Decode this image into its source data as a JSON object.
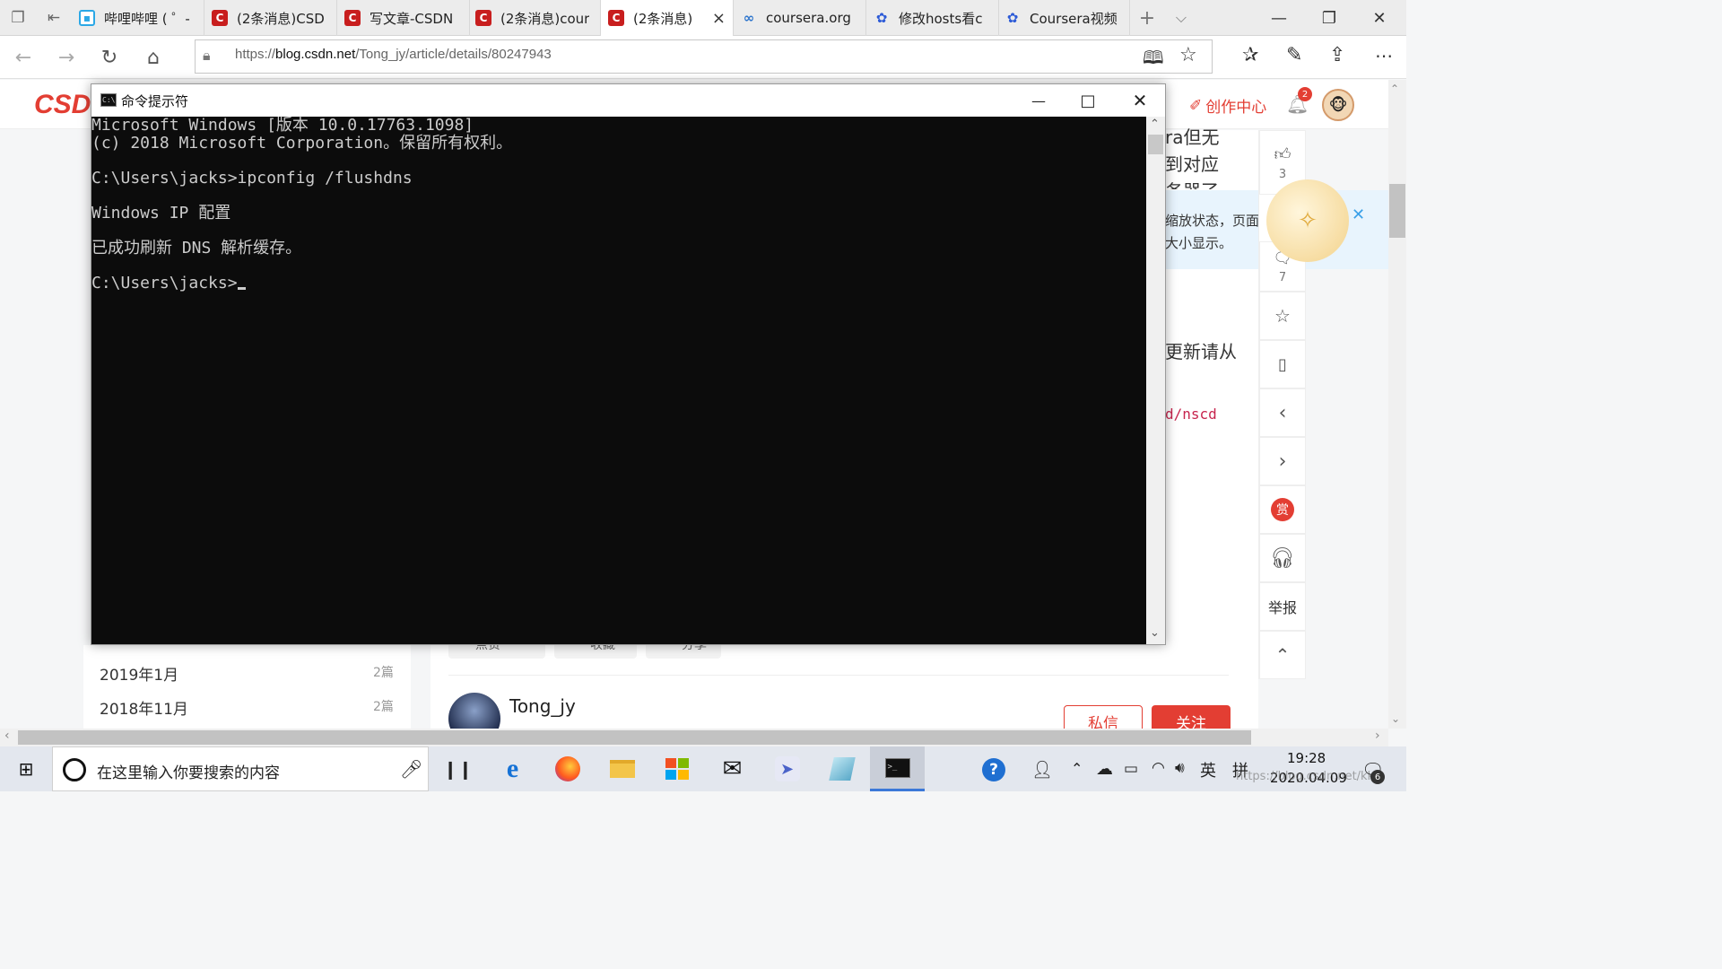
{
  "browser": {
    "tabs": [
      {
        "title": "哔哩哔哩 ( ゜-",
        "icon": "bilibili-icon",
        "kind": "bili"
      },
      {
        "title": "(2条消息)CSD",
        "icon": "csdn-icon",
        "kind": "csdn"
      },
      {
        "title": "写文章-CSDN",
        "icon": "csdn-icon",
        "kind": "csdn"
      },
      {
        "title": "(2条消息)cour",
        "icon": "csdn-icon",
        "kind": "csdn"
      },
      {
        "title": "(2条消息)",
        "icon": "csdn-icon",
        "kind": "csdn",
        "active": true
      },
      {
        "title": "coursera.org",
        "icon": "coursera-icon",
        "kind": "cour"
      },
      {
        "title": "修改hosts看c",
        "icon": "baidu-paw-icon",
        "kind": "baidu"
      },
      {
        "title": "Coursera视频",
        "icon": "baidu-paw-icon",
        "kind": "baidu"
      }
    ],
    "url_prefix": "https://",
    "url_domain": "blog.csdn.net",
    "url_path": "/Tong_jy/article/details/80247943"
  },
  "csdn": {
    "logo": "CSD",
    "create_center": "创作中心",
    "notif_count": "2",
    "like_count": "3",
    "comment_count": "7",
    "report_label": "举报",
    "reward_glyph": "赏",
    "text_fragments": {
      "l1": "ra但无",
      "l2": "到对应",
      "l3": "务器了",
      "l4": "缩放状态，页面",
      "l5": "大小显示。",
      "l6": "更新请从",
      "code": "d/nscd"
    },
    "archive": [
      {
        "month": "2019年1月",
        "count": "2篇"
      },
      {
        "month": "2018年11月",
        "count": "2篇"
      }
    ],
    "actions": {
      "like": "点赞",
      "like_count": "3",
      "collect": "收藏",
      "share": "分享"
    },
    "author": "Tong_jy",
    "message_button": "私信",
    "follow_button": "关注",
    "accent": "#e33e33"
  },
  "cmd": {
    "title": "命令提示符",
    "lines": [
      "Microsoft Windows [版本 10.0.17763.1098]",
      "(c) 2018 Microsoft Corporation。保留所有权利。",
      "",
      "C:\\Users\\jacks>ipconfig /flushdns",
      "",
      "Windows IP 配置",
      "",
      "已成功刷新 DNS 解析缓存。",
      "",
      "C:\\Users\\jacks>"
    ]
  },
  "taskbar": {
    "search_placeholder": "在这里输入你要搜索的内容",
    "time": "19:28",
    "date": "2020.04.09",
    "ime": "英",
    "ime2": "拼",
    "notif_badge": "6",
    "watermark": "https://blog.csdn.net/kklg"
  }
}
